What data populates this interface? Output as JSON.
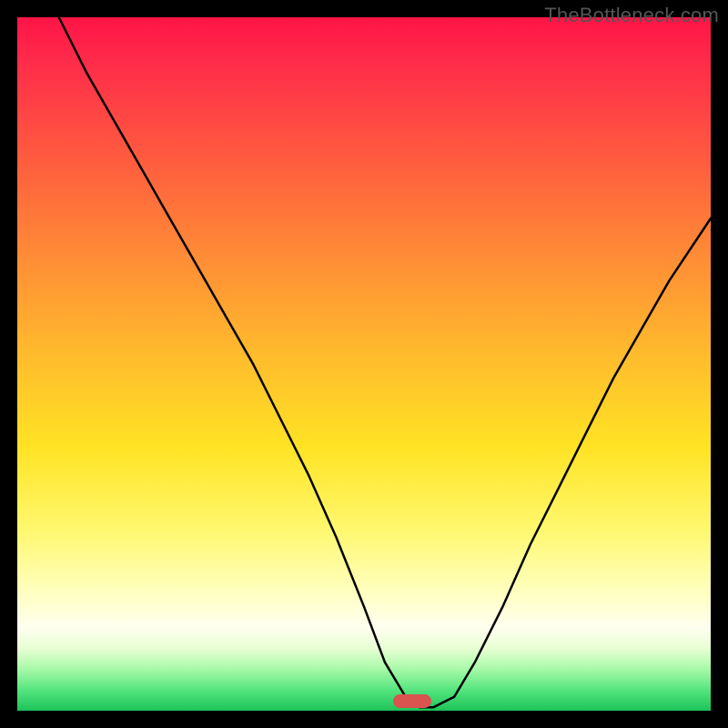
{
  "watermark": "TheBottleneck.com",
  "chart_data": {
    "type": "line",
    "title": "",
    "xlabel": "",
    "ylabel": "",
    "xlim": [
      0,
      100
    ],
    "ylim": [
      0,
      100
    ],
    "grid": false,
    "legend": false,
    "background": "vertical-gradient red→yellow→green",
    "series": [
      {
        "name": "curve",
        "x": [
          6,
          10,
          14,
          18,
          22,
          26,
          30,
          34,
          38,
          42,
          46,
          50,
          53,
          56,
          58,
          60,
          63,
          66,
          70,
          74,
          78,
          82,
          86,
          90,
          94,
          98,
          100
        ],
        "y": [
          100,
          92,
          85,
          78,
          71,
          64,
          57,
          50,
          42,
          34,
          25,
          15,
          7,
          2,
          0.5,
          0.5,
          2,
          7,
          15,
          24,
          32,
          40,
          48,
          55,
          62,
          68,
          71
        ],
        "color": "#000000",
        "stroke_width": 2.5
      }
    ],
    "marker": {
      "shape": "rounded-bar",
      "color": "#d9534f",
      "x_pct": 57,
      "y_pct": 98.6,
      "width_pct": 5.5,
      "height_pct": 1.9
    }
  }
}
